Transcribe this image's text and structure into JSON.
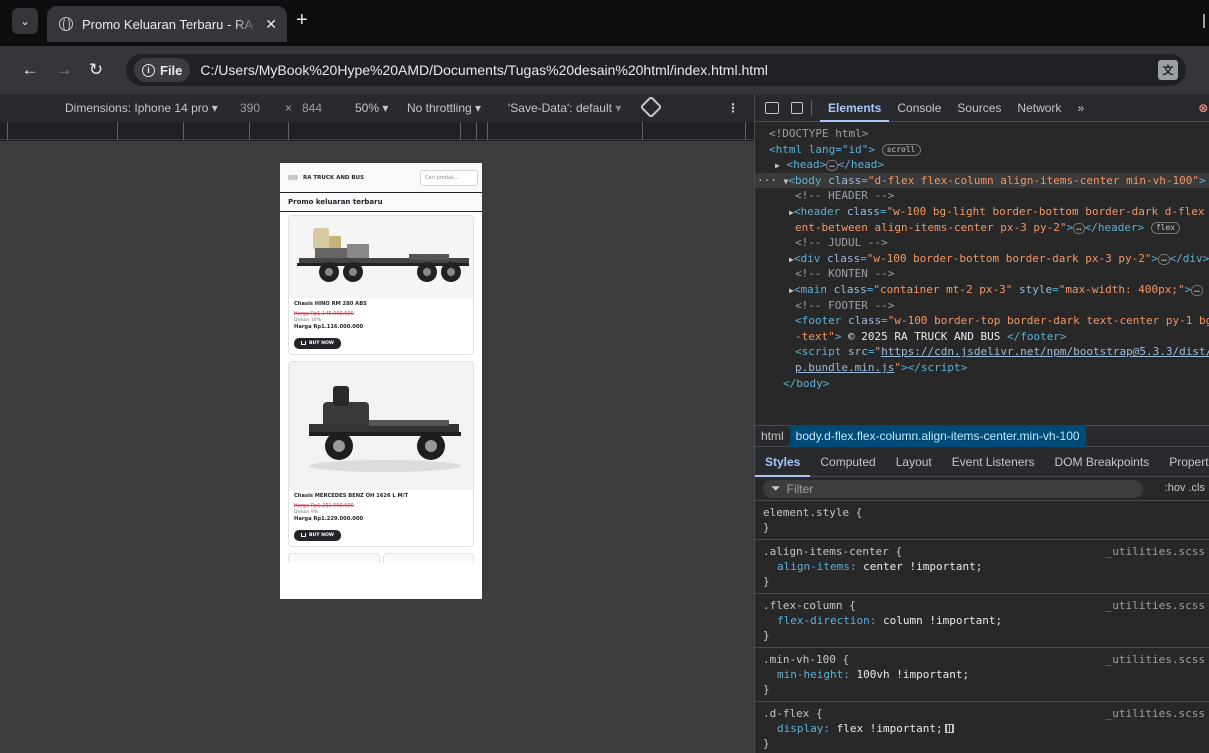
{
  "browser": {
    "tab_title": "Promo Keluaran Terbaru - RA TRUCK AND BUS",
    "url_chip": "File",
    "url": "C:/Users/MyBook%20Hype%20AMD/Documents/Tugas%20desain%20html/index.html.html"
  },
  "device_toolbar": {
    "dimensions_label": "Dimensions: Iphone 14 pro",
    "width": "390",
    "times": "×",
    "height": "844",
    "zoom": "50%",
    "throttling": "No throttling",
    "save_data": "'Save-Data': default"
  },
  "page": {
    "brand": "RA TRUCK AND BUS",
    "search_placeholder": "Cari produk...",
    "section_title": "Promo keluaran terbaru",
    "products": [
      {
        "name": "Chasis HINO RM 280 ABS",
        "old_price": "Harga Rp1.145.000.000",
        "discount": "Diskon 10%",
        "new_price": "Harga Rp1.116.000.000",
        "button": "BUY NOW"
      },
      {
        "name": "Chasis MERCEDES BENZ OH 1626 L M/T",
        "old_price": "Harga Rp1.231.000.000",
        "discount": "Diskon 9%",
        "new_price": "Harga Rp1.229.000.000",
        "button": "BUY NOW"
      }
    ]
  },
  "devtools": {
    "tabs": [
      "Elements",
      "Console",
      "Sources",
      "Network",
      "»"
    ],
    "error_count": "1",
    "dom_lines": {
      "doctype": "<!DOCTYPE html>",
      "html_open": "<html lang=\"id\">",
      "head": "<head> </head>",
      "comment_header": "<!-- HEADER -->",
      "comment_judul": "<!-- JUDUL -->",
      "comment_konten": "<!-- KONTEN -->",
      "comment_footer": "<!-- FOOTER -->",
      "footer_text": "© 2025 RA TRUCK AND BUS",
      "script_src": "https://cdn.jsdelivr.net/npm/bootstrap@5.3.3/dist/js/bootstrap.bundle.min.js",
      "body_close": "</body>"
    },
    "crumbs": [
      "html",
      "body.d-flex.flex-column.align-items-center.min-vh-100"
    ],
    "styles_tabs": [
      "Styles",
      "Computed",
      "Layout",
      "Event Listeners",
      "DOM Breakpoints",
      "Properties"
    ],
    "filter_placeholder": "Filter",
    "filter_right": ":hov .cls",
    "rules": [
      {
        "selector": "element.style {",
        "props": [],
        "source": ""
      },
      {
        "selector": ".align-items-center {",
        "props": [
          [
            "align-items",
            "center !important;"
          ]
        ],
        "source": "_utilities.scss"
      },
      {
        "selector": ".flex-column {",
        "props": [
          [
            "flex-direction",
            "column !important;"
          ]
        ],
        "source": "_utilities.scss"
      },
      {
        "selector": ".min-vh-100 {",
        "props": [
          [
            "min-height",
            "100vh !important;"
          ]
        ],
        "source": "_utilities.scss"
      },
      {
        "selector": ".d-flex {",
        "props": [
          [
            "display",
            "flex !important;"
          ]
        ],
        "source": "_utilities.scss"
      }
    ]
  }
}
